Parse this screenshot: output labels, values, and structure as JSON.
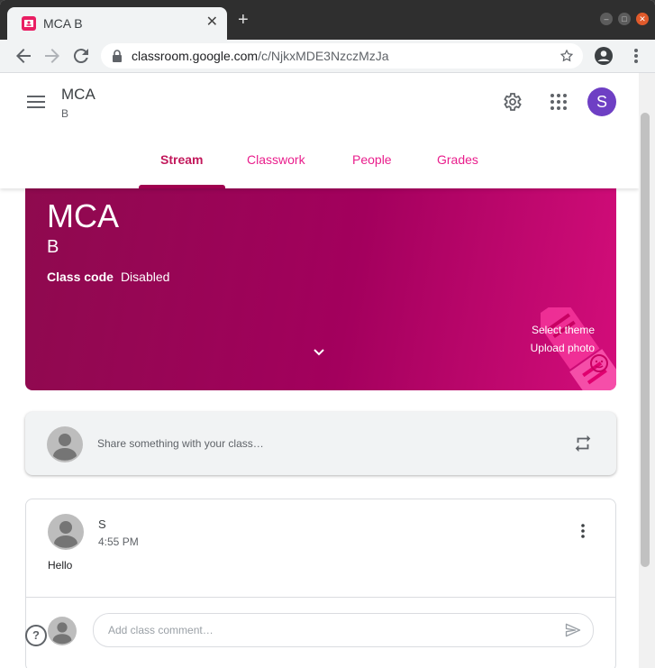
{
  "browser": {
    "tab_title": "MCA B",
    "url_host": "classroom.google.com",
    "url_path": "/c/NjkxMDE3NzczMzJa"
  },
  "app": {
    "class_name": "MCA",
    "class_section": "B",
    "avatar_letter": "S",
    "tabs": [
      {
        "label": "Stream"
      },
      {
        "label": "Classwork"
      },
      {
        "label": "People"
      },
      {
        "label": "Grades"
      }
    ]
  },
  "banner": {
    "title": "MCA",
    "section": "B",
    "class_code_label": "Class code",
    "class_code_value": "Disabled",
    "select_theme": "Select theme",
    "upload_photo": "Upload photo"
  },
  "share": {
    "placeholder": "Share something with your class…"
  },
  "post": {
    "author": "S",
    "time": "4:55 PM",
    "body": "Hello",
    "comment_placeholder": "Add class comment…"
  },
  "help": {
    "glyph": "?"
  },
  "colors": {
    "accent": "#e91e8c",
    "active_tab": "#c2185b",
    "banner": "#a3005d",
    "avatar": "#6e3fc4"
  }
}
